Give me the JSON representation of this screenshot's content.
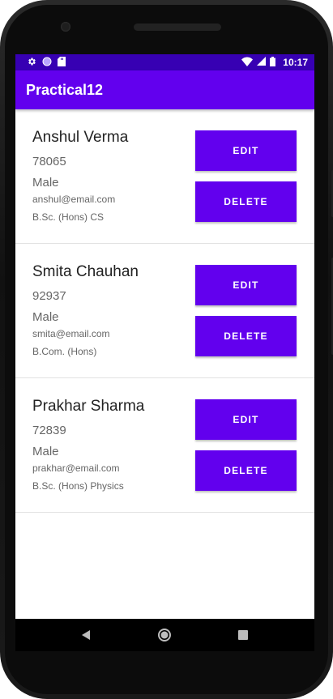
{
  "status_bar": {
    "time": "10:17",
    "left_icons": [
      "settings-gear-icon",
      "circle-icon",
      "sd-card-icon"
    ],
    "right_icons": [
      "wifi-icon",
      "signal-icon",
      "battery-icon"
    ]
  },
  "app_bar": {
    "title": "Practical12"
  },
  "students": [
    {
      "name": "Anshul Verma",
      "phone": "78065",
      "gender": "Male",
      "email": "anshul@email.com",
      "course": "B.Sc. (Hons) CS",
      "edit_label": "EDIT",
      "delete_label": "DELETE"
    },
    {
      "name": "Smita Chauhan",
      "phone": "92937",
      "gender": "Male",
      "email": "smita@email.com",
      "course": "B.Com. (Hons)",
      "edit_label": "EDIT",
      "delete_label": "DELETE"
    },
    {
      "name": "Prakhar Sharma",
      "phone": "72839",
      "gender": "Male",
      "email": "prakhar@email.com",
      "course": "B.Sc. (Hons) Physics",
      "edit_label": "EDIT",
      "delete_label": "DELETE"
    }
  ],
  "nav_bar": {
    "buttons": [
      "back-icon",
      "home-icon",
      "recents-icon"
    ]
  },
  "colors": {
    "primary": "#6200ee",
    "primary_dark": "#3700b3"
  }
}
